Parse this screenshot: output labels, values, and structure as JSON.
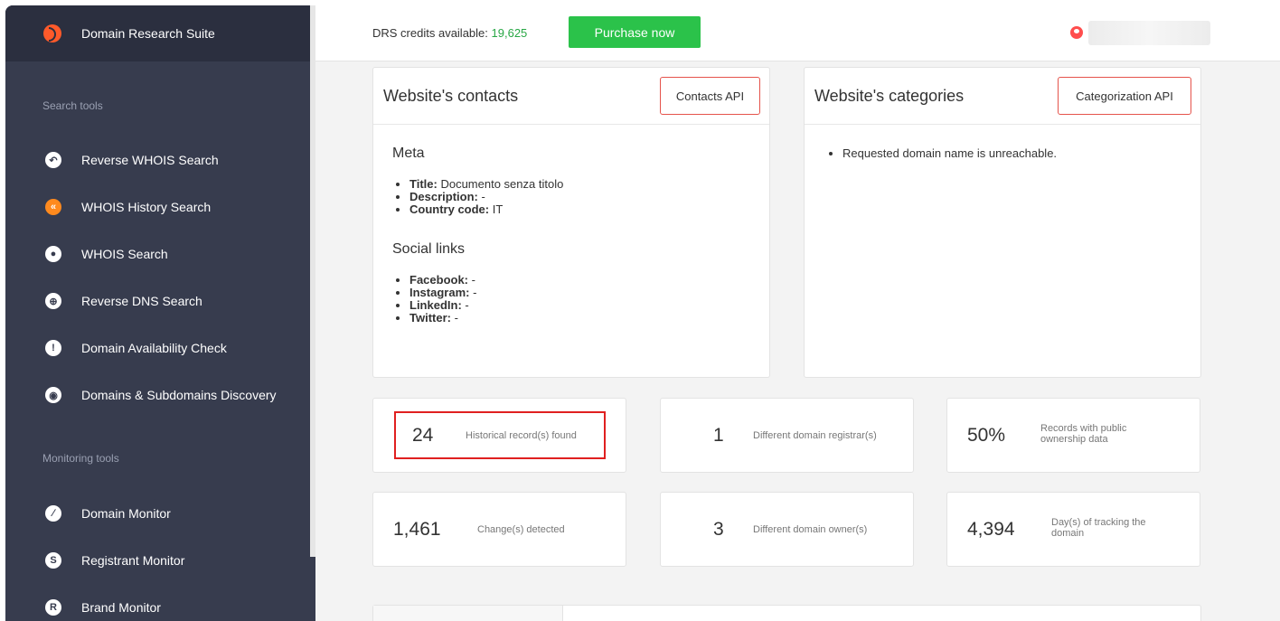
{
  "sidebar": {
    "brand": "Domain Research Suite",
    "sections": [
      {
        "label": "Search tools",
        "items": [
          {
            "label": "Reverse WHOIS Search",
            "icon": "reverse-whois-icon"
          },
          {
            "label": "WHOIS History Search",
            "icon": "whois-history-icon",
            "active": true
          },
          {
            "label": "WHOIS Search",
            "icon": "whois-icon"
          },
          {
            "label": "Reverse DNS Search",
            "icon": "globe-icon"
          },
          {
            "label": "Domain Availability Check",
            "icon": "exclamation-icon"
          },
          {
            "label": "Domains & Subdomains Discovery",
            "icon": "discovery-icon"
          }
        ]
      },
      {
        "label": "Monitoring tools",
        "items": [
          {
            "label": "Domain Monitor",
            "icon": "domain-monitor-icon"
          },
          {
            "label": "Registrant Monitor",
            "icon": "registrant-monitor-icon"
          },
          {
            "label": "Brand Monitor",
            "icon": "registered-mark-icon"
          }
        ]
      }
    ]
  },
  "topbar": {
    "credits_label": "DRS credits available:",
    "credits_value": "19,625",
    "purchase_label": "Purchase now"
  },
  "contacts": {
    "title": "Website's contacts",
    "api_button": "Contacts API",
    "meta_heading": "Meta",
    "meta": [
      {
        "key": "Title:",
        "value": "Documento senza titolo"
      },
      {
        "key": "Description:",
        "value": "-"
      },
      {
        "key": "Country code:",
        "value": "IT"
      }
    ],
    "social_heading": "Social links",
    "social": [
      {
        "key": "Facebook:",
        "value": "-"
      },
      {
        "key": "Instagram:",
        "value": "-"
      },
      {
        "key": "LinkedIn:",
        "value": "-"
      },
      {
        "key": "Twitter:",
        "value": "-"
      }
    ]
  },
  "categories": {
    "title": "Website's categories",
    "api_button": "Categorization API",
    "message": "Requested domain name is unreachable."
  },
  "stats": [
    {
      "value": "24",
      "label": "Historical record(s) found",
      "highlighted": true
    },
    {
      "value": "1",
      "label": "Different domain registrar(s)"
    },
    {
      "value": "50%",
      "label": "Records with public ownership data"
    },
    {
      "value": "1,461",
      "label": "Change(s) detected"
    },
    {
      "value": "3",
      "label": "Different domain owner(s)"
    },
    {
      "value": "4,394",
      "label": "Day(s) of tracking the domain"
    }
  ],
  "colors": {
    "sidebar_bg": "#373c4e",
    "accent_orange": "#ff8a1e",
    "purchase_green": "#2bc24a",
    "credits_green": "#28a745",
    "highlight_red": "#e02020"
  }
}
